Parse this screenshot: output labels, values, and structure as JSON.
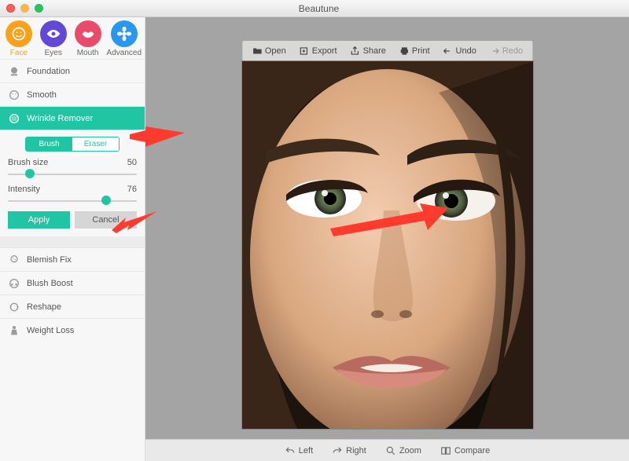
{
  "window": {
    "title": "Beautune"
  },
  "colors": {
    "accent": "#20c6a4",
    "face": "#f9a11b",
    "eyes": "#6148d6",
    "mouth": "#e84c6a",
    "advanced": "#2996f0"
  },
  "tabs": [
    {
      "id": "face",
      "label": "Face",
      "active": true
    },
    {
      "id": "eyes",
      "label": "Eyes",
      "active": false
    },
    {
      "id": "mouth",
      "label": "Mouth",
      "active": false
    },
    {
      "id": "advanced",
      "label": "Advanced",
      "active": false
    }
  ],
  "tools_top": [
    {
      "id": "foundation",
      "label": "Foundation"
    },
    {
      "id": "smooth",
      "label": "Smooth"
    }
  ],
  "active_tool": {
    "id": "wrinkle",
    "label": "Wrinkle Remover"
  },
  "tools_bottom": [
    {
      "id": "blemish",
      "label": "Blemish Fix"
    },
    {
      "id": "blush",
      "label": "Blush Boost"
    },
    {
      "id": "reshape",
      "label": "Reshape"
    },
    {
      "id": "weight",
      "label": "Weight Loss"
    }
  ],
  "options": {
    "mode": {
      "brush": "Brush",
      "eraser": "Eraser",
      "active": "brush"
    },
    "brush_size": {
      "label": "Brush size",
      "value": 50,
      "percent": 17
    },
    "intensity": {
      "label": "Intensity",
      "value": 76,
      "percent": 76
    },
    "apply": "Apply",
    "cancel": "Cancel"
  },
  "toolbar": [
    {
      "id": "open",
      "label": "Open"
    },
    {
      "id": "export",
      "label": "Export"
    },
    {
      "id": "share",
      "label": "Share"
    },
    {
      "id": "print",
      "label": "Print"
    },
    {
      "id": "undo",
      "label": "Undo"
    },
    {
      "id": "redo",
      "label": "Redo",
      "disabled": true
    }
  ],
  "bottombar": [
    {
      "id": "left",
      "label": "Left"
    },
    {
      "id": "right",
      "label": "Right"
    },
    {
      "id": "zoom",
      "label": "Zoom"
    },
    {
      "id": "compare",
      "label": "Compare"
    }
  ]
}
